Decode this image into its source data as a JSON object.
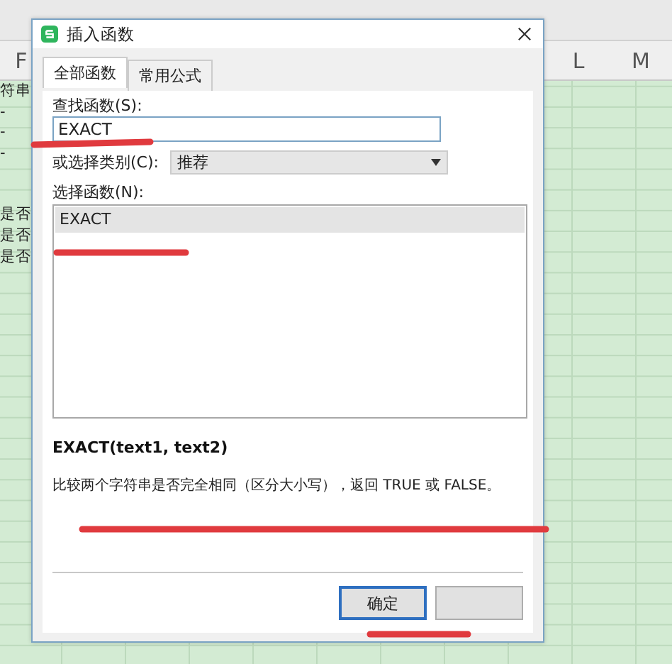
{
  "spreadsheet": {
    "left_column_headers": [
      "F"
    ],
    "right_column_headers": [
      "L",
      "M"
    ],
    "cells_upper": [
      "符串",
      "-",
      "-",
      "-"
    ],
    "cells_lower": [
      "是否",
      "是否",
      "是否"
    ]
  },
  "dialog": {
    "title": "插入函数",
    "tabs": [
      {
        "label": "全部函数",
        "selected": true
      },
      {
        "label": "常用公式",
        "selected": false
      }
    ],
    "search_label": "查找函数(S):",
    "search_value": "EXACT",
    "category_label": "或选择类别(C):",
    "category_value": "推荐",
    "function_list_label": "选择函数(N):",
    "functions": [
      {
        "name": "EXACT",
        "selected": true
      }
    ],
    "signature": "EXACT(text1, text2)",
    "description": "比较两个字符串是否完全相同（区分大小写），返回 TRUE 或 FALSE。",
    "buttons": [
      {
        "label": "确定",
        "focused": true
      },
      {
        "focused": false
      }
    ]
  }
}
